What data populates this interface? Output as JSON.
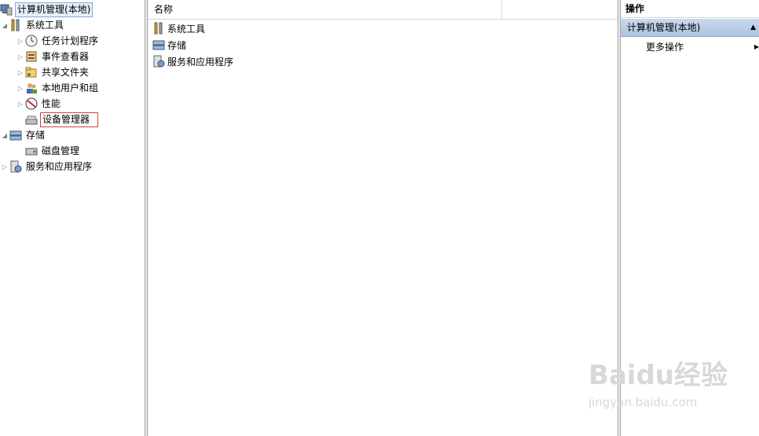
{
  "tree": {
    "root": "计算机管理(本地)",
    "items": [
      {
        "label": "系统工具",
        "icon": "tools-icon"
      },
      {
        "label": "任务计划程序",
        "icon": "clock-icon"
      },
      {
        "label": "事件查看器",
        "icon": "event-viewer-icon"
      },
      {
        "label": "共享文件夹",
        "icon": "shared-folder-icon"
      },
      {
        "label": "本地用户和组",
        "icon": "users-icon"
      },
      {
        "label": "性能",
        "icon": "performance-icon"
      },
      {
        "label": "设备管理器",
        "icon": "device-manager-icon"
      },
      {
        "label": "存储",
        "icon": "storage-icon"
      },
      {
        "label": "磁盘管理",
        "icon": "disk-icon"
      },
      {
        "label": "服务和应用程序",
        "icon": "services-icon"
      }
    ]
  },
  "list": {
    "column_name": "名称",
    "rows": [
      "系统工具",
      "存储",
      "服务和应用程序"
    ]
  },
  "actions": {
    "header": "操作",
    "section": "计算机管理(本地)",
    "more": "更多操作"
  },
  "watermark": {
    "brand": "Baidu经验",
    "url": "jingyan.baidu.com"
  }
}
